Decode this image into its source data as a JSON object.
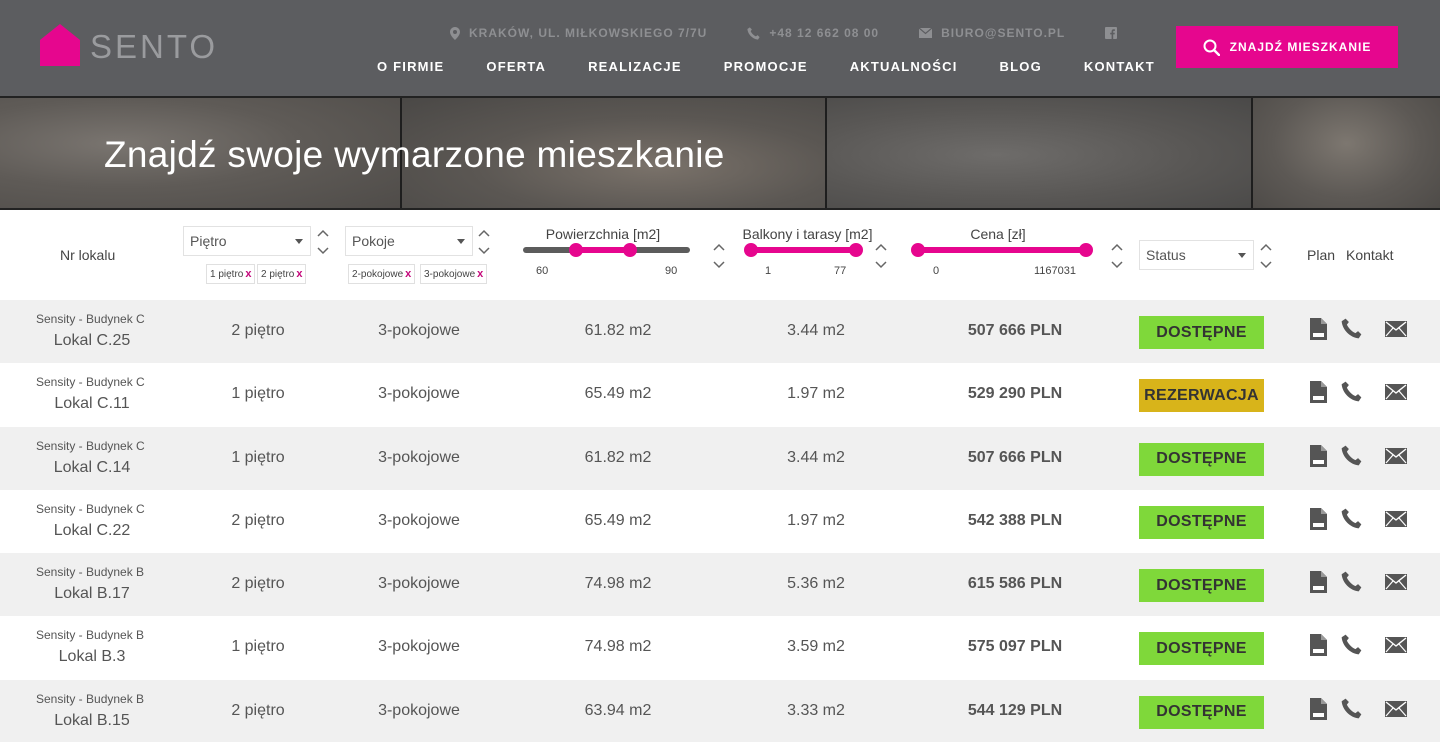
{
  "header": {
    "logo_text": "SENTO",
    "address": "KRAKÓW, UL. MIŁKOWSKIEGO 7/7U",
    "phone": "+48 12 662 08 00",
    "email": "BIURO@SENTO.PL",
    "find_button": "ZNAJDŹ MIESZKANIE",
    "nav": [
      "O FIRMIE",
      "OFERTA",
      "REALIZACJE",
      "PROMOCJE",
      "AKTUALNOŚCI",
      "BLOG",
      "KONTAKT"
    ]
  },
  "hero": {
    "title": "Znajdź swoje wymarzone mieszkanie"
  },
  "filters": {
    "nr_lokalu": "Nr lokalu",
    "pietro": {
      "value": "Piętro",
      "tags": [
        "1 piętro",
        "2 piętro"
      ]
    },
    "pokoje": {
      "value": "Pokoje",
      "tags": [
        "2-pokojowe",
        "3-pokojowe"
      ]
    },
    "powierzchnia": {
      "label": "Powierzchnia  [m2]",
      "min": "60",
      "max": "90",
      "low_fraction": 0.32,
      "high_fraction": 0.64
    },
    "balkony": {
      "label": "Balkony i tarasy  [m2]",
      "min": "1",
      "max": "77",
      "low_fraction": 0.0,
      "high_fraction": 1.0
    },
    "cena": {
      "label": "Cena   [zł]",
      "min": "0",
      "max": "1167031",
      "low_fraction": 0.0,
      "high_fraction": 1.0
    },
    "status": {
      "value": "Status"
    },
    "plan": "Plan",
    "kontakt": "Kontakt",
    "tag_remove": "x"
  },
  "colors": {
    "accent": "#e6068e",
    "available": "#7fd83a",
    "reserved": "#d8b41a",
    "header_bg": "#5c5d60"
  },
  "rows": [
    {
      "building": "Sensity - Budynek C",
      "unit": "Lokal C.25",
      "floor": "2 piętro",
      "rooms": "3-pokojowe",
      "area": "61.82 m2",
      "balcony": "3.44 m2",
      "price": "507 666 PLN",
      "status": "DOSTĘPNE",
      "status_type": "available"
    },
    {
      "building": "Sensity - Budynek C",
      "unit": "Lokal C.11",
      "floor": "1 piętro",
      "rooms": "3-pokojowe",
      "area": "65.49 m2",
      "balcony": "1.97 m2",
      "price": "529 290 PLN",
      "status": "REZERWACJA",
      "status_type": "reserved"
    },
    {
      "building": "Sensity - Budynek C",
      "unit": "Lokal C.14",
      "floor": "1 piętro",
      "rooms": "3-pokojowe",
      "area": "61.82 m2",
      "balcony": "3.44 m2",
      "price": "507 666 PLN",
      "status": "DOSTĘPNE",
      "status_type": "available"
    },
    {
      "building": "Sensity - Budynek C",
      "unit": "Lokal C.22",
      "floor": "2 piętro",
      "rooms": "3-pokojowe",
      "area": "65.49 m2",
      "balcony": "1.97 m2",
      "price": "542 388 PLN",
      "status": "DOSTĘPNE",
      "status_type": "available"
    },
    {
      "building": "Sensity - Budynek B",
      "unit": "Lokal B.17",
      "floor": "2 piętro",
      "rooms": "3-pokojowe",
      "area": "74.98 m2",
      "balcony": "5.36 m2",
      "price": "615 586 PLN",
      "status": "DOSTĘPNE",
      "status_type": "available"
    },
    {
      "building": "Sensity - Budynek B",
      "unit": "Lokal B.3",
      "floor": "1 piętro",
      "rooms": "3-pokojowe",
      "area": "74.98 m2",
      "balcony": "3.59 m2",
      "price": "575 097 PLN",
      "status": "DOSTĘPNE",
      "status_type": "available"
    },
    {
      "building": "Sensity - Budynek B",
      "unit": "Lokal B.15",
      "floor": "2 piętro",
      "rooms": "3-pokojowe",
      "area": "63.94 m2",
      "balcony": "3.33 m2",
      "price": "544 129 PLN",
      "status": "DOSTĘPNE",
      "status_type": "available"
    }
  ]
}
